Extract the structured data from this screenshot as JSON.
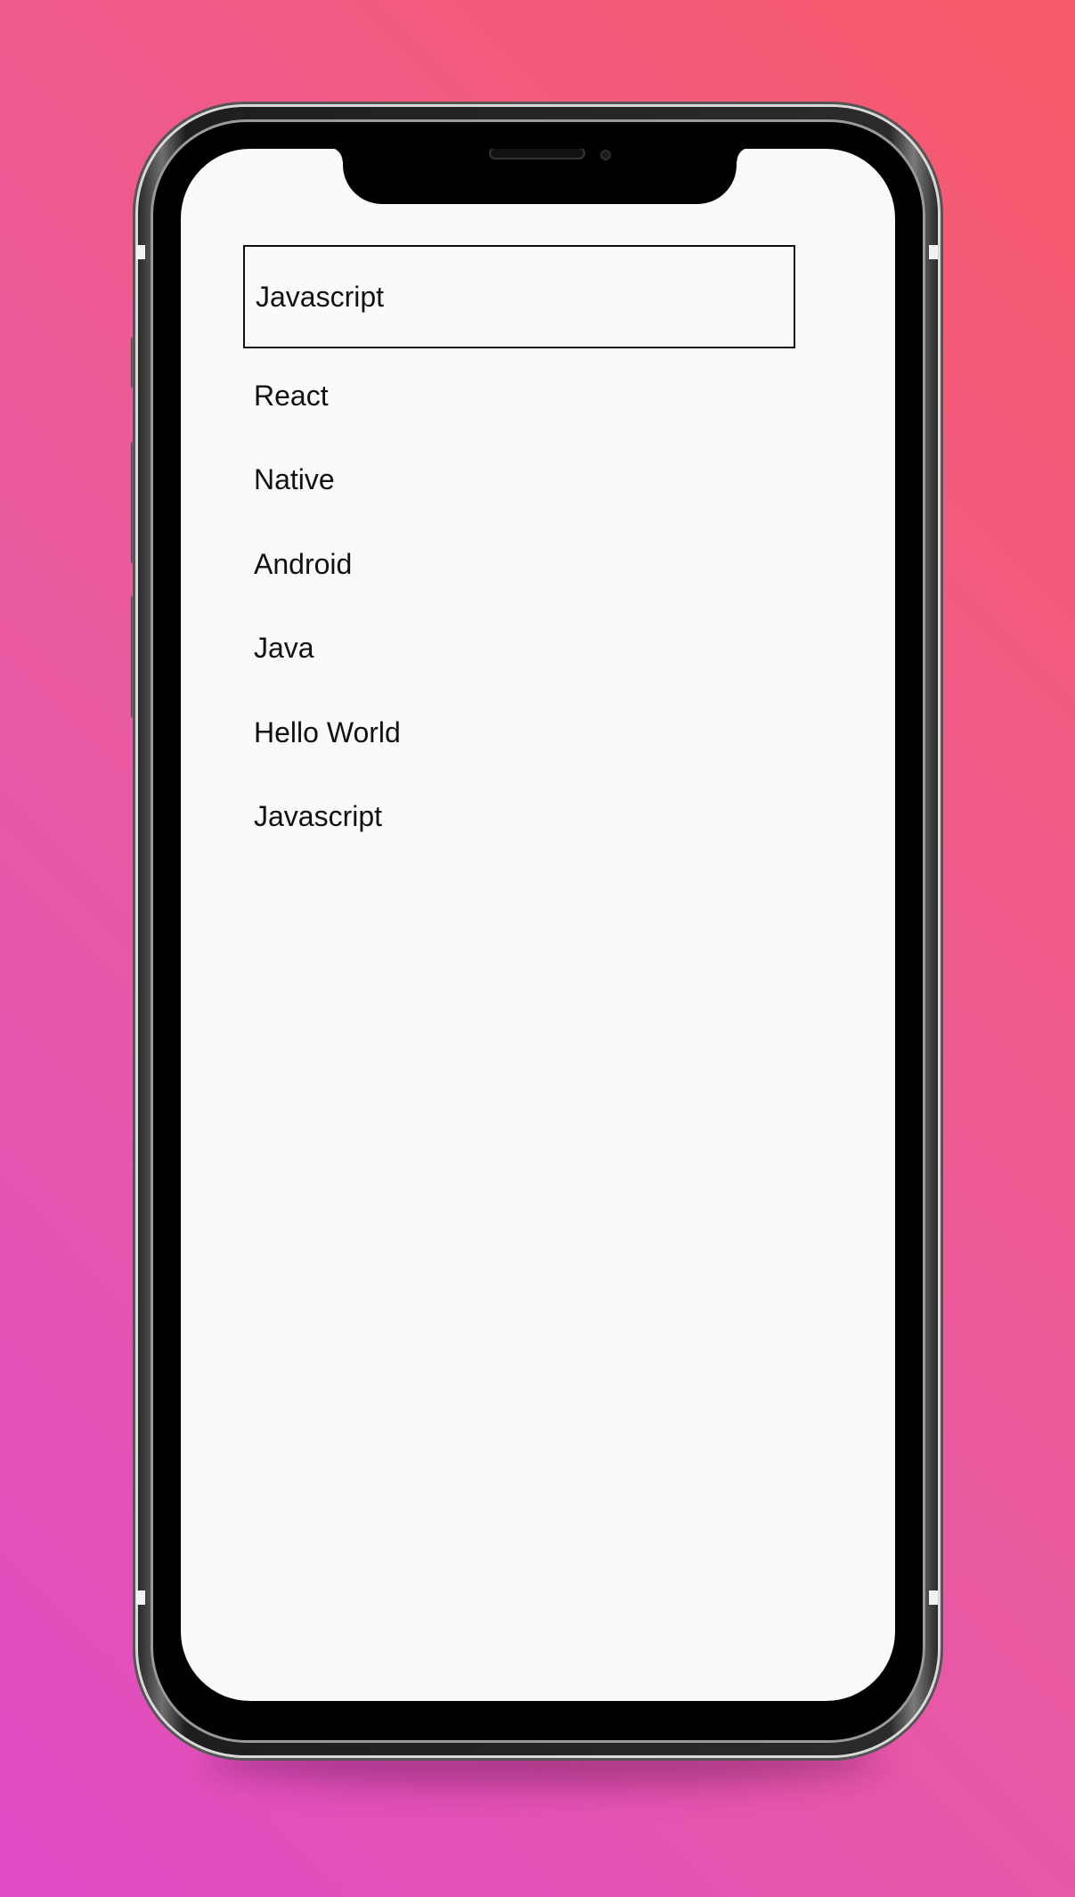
{
  "app": {
    "selected_item": "Javascript",
    "items": [
      {
        "label": "React"
      },
      {
        "label": "Native"
      },
      {
        "label": "Android"
      },
      {
        "label": "Java"
      },
      {
        "label": "Hello World"
      },
      {
        "label": "Javascript"
      }
    ]
  },
  "colors": {
    "screen_background": "#fafafa",
    "text": "#111111",
    "gradient_start": "#e04bc6",
    "gradient_end": "#f75a68"
  }
}
